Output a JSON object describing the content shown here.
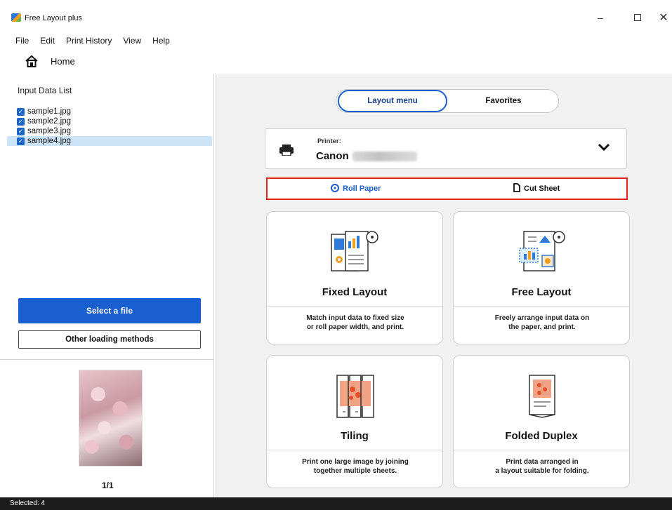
{
  "window": {
    "title": "Free Layout plus",
    "min_glyph": "–",
    "close_glyph": "✕"
  },
  "menu": [
    "File",
    "Edit",
    "Print History",
    "View",
    "Help"
  ],
  "home": {
    "label": "Home"
  },
  "input_list": {
    "title": "Input Data List",
    "files": [
      {
        "name": "sample1.jpg",
        "checked": true,
        "selected": false
      },
      {
        "name": "sample2.jpg",
        "checked": true,
        "selected": false
      },
      {
        "name": "sample3.jpg",
        "checked": true,
        "selected": false
      },
      {
        "name": "sample4.jpg",
        "checked": true,
        "selected": true
      }
    ],
    "select_file": "Select a file",
    "other_methods": "Other loading methods",
    "page_counter": "1/1"
  },
  "tabs": {
    "layout_menu": "Layout menu",
    "favorites": "Favorites"
  },
  "printer": {
    "label": "Printer:",
    "name": "Canon"
  },
  "paper": {
    "roll": "Roll Paper",
    "cut": "Cut Sheet"
  },
  "colors": {
    "accent": "#1a5fd0",
    "highlight": "#e3241c",
    "selection": "#cce4f7"
  },
  "cards": [
    {
      "title": "Fixed Layout",
      "desc1": "Match input data to fixed size",
      "desc2": "or roll paper width, and print."
    },
    {
      "title": "Free Layout",
      "desc1": "Freely arrange input data on",
      "desc2": "the paper, and print."
    },
    {
      "title": "Tiling",
      "desc1": "Print one large image by joining",
      "desc2": "together multiple sheets."
    },
    {
      "title": "Folded Duplex",
      "desc1": "Print data arranged in",
      "desc2": "a layout suitable for folding."
    }
  ],
  "status": {
    "text": "Selected: 4"
  }
}
